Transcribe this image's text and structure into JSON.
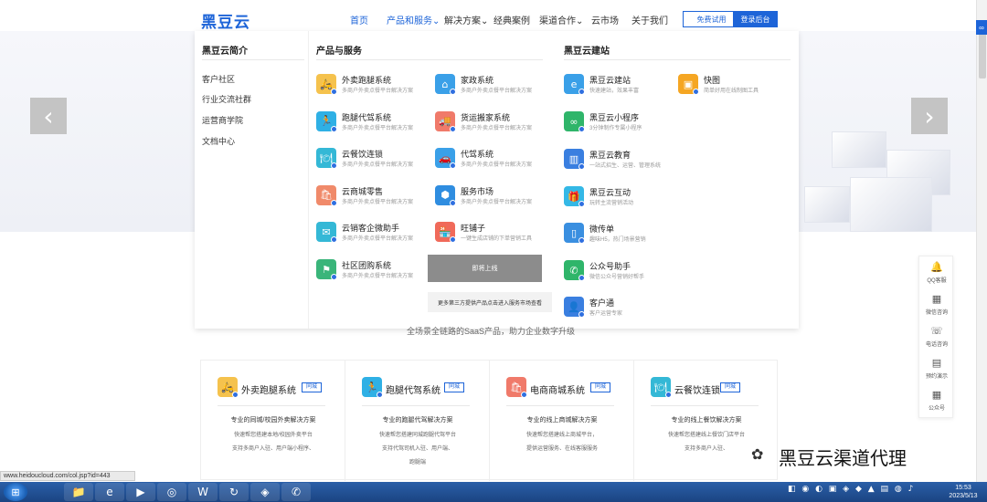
{
  "navbar": {
    "logo": "黑豆云",
    "items": [
      {
        "label": "首页",
        "active": true
      },
      {
        "label": "产品和服务",
        "active": true,
        "caret": "⌄"
      },
      {
        "label": "解决方案",
        "caret": "⌄"
      },
      {
        "label": "经典案例"
      },
      {
        "label": "渠道合作",
        "caret": "⌄"
      },
      {
        "label": "云市场"
      },
      {
        "label": "关于我们"
      }
    ],
    "trial_label": "免费试用",
    "login_label": "登录后台"
  },
  "mega_menu": {
    "intro": {
      "title": "黑豆云简介",
      "links": [
        "客户社区",
        "行业交流社群",
        "运营商学院",
        "文档中心"
      ]
    },
    "products": {
      "title": "产品与服务",
      "items": [
        {
          "title": "外卖跑腿系统",
          "desc": "多商户外卖点餐平台解决方案",
          "icon": "delivery-icon",
          "color": "#f5c24d"
        },
        {
          "title": "家政系统",
          "desc": "多商户外卖点餐平台解决方案",
          "icon": "house-icon",
          "color": "#3aa0e8"
        },
        {
          "title": "跑腿代驾系统",
          "desc": "多商户外卖点餐平台解决方案",
          "icon": "runner-icon",
          "color": "#2fb0e5"
        },
        {
          "title": "货运搬家系统",
          "desc": "多商户外卖点餐平台解决方案",
          "icon": "truck-icon",
          "color": "#f07a6a"
        },
        {
          "title": "云餐饮连锁",
          "desc": "多商户外卖点餐平台解决方案",
          "icon": "dining-icon",
          "color": "#34b8d6"
        },
        {
          "title": "代驾系统",
          "desc": "多商户外卖点餐平台解决方案",
          "icon": "car-icon",
          "color": "#3aa0e8"
        },
        {
          "title": "云商城零售",
          "desc": "多商户外卖点餐平台解决方案",
          "icon": "shop-icon",
          "color": "#f08a6a"
        },
        {
          "title": "服务市场",
          "desc": "多商户外卖点餐平台解决方案",
          "icon": "market-icon",
          "color": "#2f8de0"
        },
        {
          "title": "云销客企微助手",
          "desc": "多商户外卖点餐平台解决方案",
          "icon": "chat-icon",
          "color": "#34b8d6"
        },
        {
          "title": "旺铺子",
          "desc": "一键生成店铺的下单营销工具",
          "icon": "store-icon",
          "color": "#f06a5a"
        },
        {
          "title": "社区团购系统",
          "desc": "多商户外卖点餐平台解决方案",
          "icon": "group-buy-icon",
          "color": "#3ab57a"
        }
      ],
      "overlay_label": "即将上线",
      "more_link": "更多第三方提供产品点击进入服务市场查看"
    },
    "build": {
      "title": "黑豆云建站",
      "items": [
        {
          "title": "黑豆云建站",
          "desc": "快速建站，效果丰富",
          "icon": "browser-icon",
          "color": "#3aa0e8"
        },
        {
          "title": "快图",
          "desc": "简单好用在线制图工具",
          "icon": "image-icon",
          "color": "#f5a623"
        },
        {
          "title": "黑豆云小程序",
          "desc": "3分钟制作专属小程序",
          "icon": "mini-program-icon",
          "color": "#2fb56a"
        },
        {
          "title": "黑豆云教育",
          "desc": "一站式招生、运营、管理系统",
          "icon": "book-icon",
          "color": "#3a7fe0"
        },
        {
          "title": "黑豆云互动",
          "desc": "玩转主流营销活动",
          "icon": "gift-icon",
          "color": "#34b8e6"
        },
        {
          "title": "微传单",
          "desc": "趣味H5，热门场景营销",
          "icon": "phone-icon",
          "color": "#3a8fe0"
        },
        {
          "title": "公众号助手",
          "desc": "微信公众号营销好帮手",
          "icon": "wechat-icon",
          "color": "#2fb56a"
        },
        {
          "title": "客户通",
          "desc": "客户运营专家",
          "icon": "user-icon",
          "color": "#3a7fe0"
        }
      ]
    }
  },
  "subtitle": "全场景全链路的SaaS产品，助力企业数字升级",
  "cards": [
    {
      "title": "外卖跑腿系统",
      "tag": "同城",
      "headline": "专业的同城/校园外卖解决方案",
      "lines": [
        "快速帮您搭建本地/校园外卖平台",
        "支持多商户入驻、用户端小程序、"
      ],
      "icon": "delivery-icon",
      "color": "#f5c24d"
    },
    {
      "title": "跑腿代驾系统",
      "tag": "同城",
      "headline": "专业的跑腿代驾解决方案",
      "lines": [
        "快速帮您搭建同城跑腿代驾平台",
        "支持代驾司机入驻、用户端、",
        "跑腿端"
      ],
      "icon": "runner-icon",
      "color": "#2fb0e5"
    },
    {
      "title": "电商商城系统",
      "tag": "同城",
      "headline": "专业的线上商城解决方案",
      "lines": [
        "快速帮您搭建线上商城平台，",
        "提供运营服务、在线客服服务"
      ],
      "icon": "shop-icon",
      "color": "#f07a6a"
    },
    {
      "title": "云餐饮连锁",
      "tag": "同城",
      "headline": "专业的线上餐饮解决方案",
      "lines": [
        "快速帮您搭建线上餐饮门店平台",
        "支持多商户入驻、"
      ],
      "icon": "dining-icon",
      "color": "#34b8d6"
    }
  ],
  "side_rail": [
    {
      "label": "QQ客服",
      "icon": "bell-icon",
      "glyph": "🔔"
    },
    {
      "label": "微信咨询",
      "icon": "qr-icon",
      "glyph": "▦"
    },
    {
      "label": "电话咨询",
      "icon": "phone-call-icon",
      "glyph": "☏"
    },
    {
      "label": "预约演示",
      "icon": "document-icon",
      "glyph": "▤"
    },
    {
      "label": "公众号",
      "icon": "qr-icon",
      "glyph": "▦"
    }
  ],
  "carousel": {
    "prev": "‹",
    "next": "›"
  },
  "watermark": "黑豆云渠道代理",
  "status_url": "www.heidoucloud.com/col.jsp?id=443",
  "taskbar": {
    "apps": [
      "folder-icon",
      "ie-icon",
      "media-icon",
      "chrome-icon",
      "office-icon",
      "refresh-icon",
      "vpn-icon",
      "wechat-icon"
    ],
    "time": "15:53",
    "date": "2023/5/13"
  }
}
